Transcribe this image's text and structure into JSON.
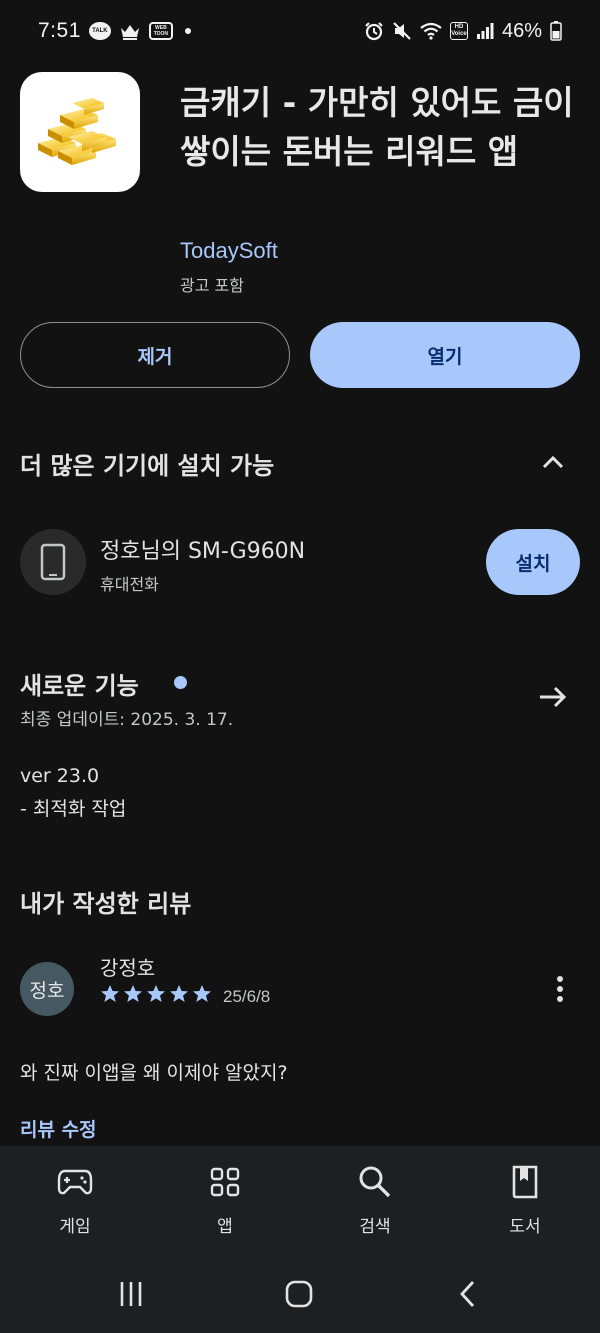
{
  "status_bar": {
    "time": "7:51",
    "talk_icon_text": "TALK",
    "webtoon_icon_text": "WEB TOON",
    "hd_icon_text": "HD Voice",
    "battery": "46%"
  },
  "app": {
    "title": "금캐기 - 가만히 있어도 금이 쌓이는 돈버는 리워드 앱",
    "developer": "TodaySoft",
    "ads_note": "광고 포함",
    "icon": "gold-bars-icon"
  },
  "actions": {
    "remove_label": "제거",
    "open_label": "열기"
  },
  "devices_section": {
    "title": "더 많은 기기에 설치 가능",
    "device_name": "정호님의 SM-G960N",
    "device_type": "휴대전화",
    "install_label": "설치"
  },
  "whats_new": {
    "title": "새로운 기능",
    "updated": "최종 업데이트: 2025. 3. 17.",
    "version": "ver 23.0",
    "note": "- 최적화 작업"
  },
  "my_review": {
    "title": "내가 작성한 리뷰",
    "avatar_text": "정호",
    "reviewer": "강정호",
    "rating": 5,
    "date": "25/6/8",
    "text": "와 진짜 이앱을 왜 이제야 알았지?",
    "edit_label": "리뷰 수정"
  },
  "bottom_nav": {
    "items": [
      {
        "label": "게임",
        "icon": "gamepad-icon"
      },
      {
        "label": "앱",
        "icon": "apps-grid-icon"
      },
      {
        "label": "검색",
        "icon": "search-icon"
      },
      {
        "label": "도서",
        "icon": "book-icon"
      }
    ]
  },
  "colors": {
    "background": "#121212",
    "accent": "#a8c7fa",
    "on_accent": "#062e6f",
    "star": "#a8c7fa"
  }
}
